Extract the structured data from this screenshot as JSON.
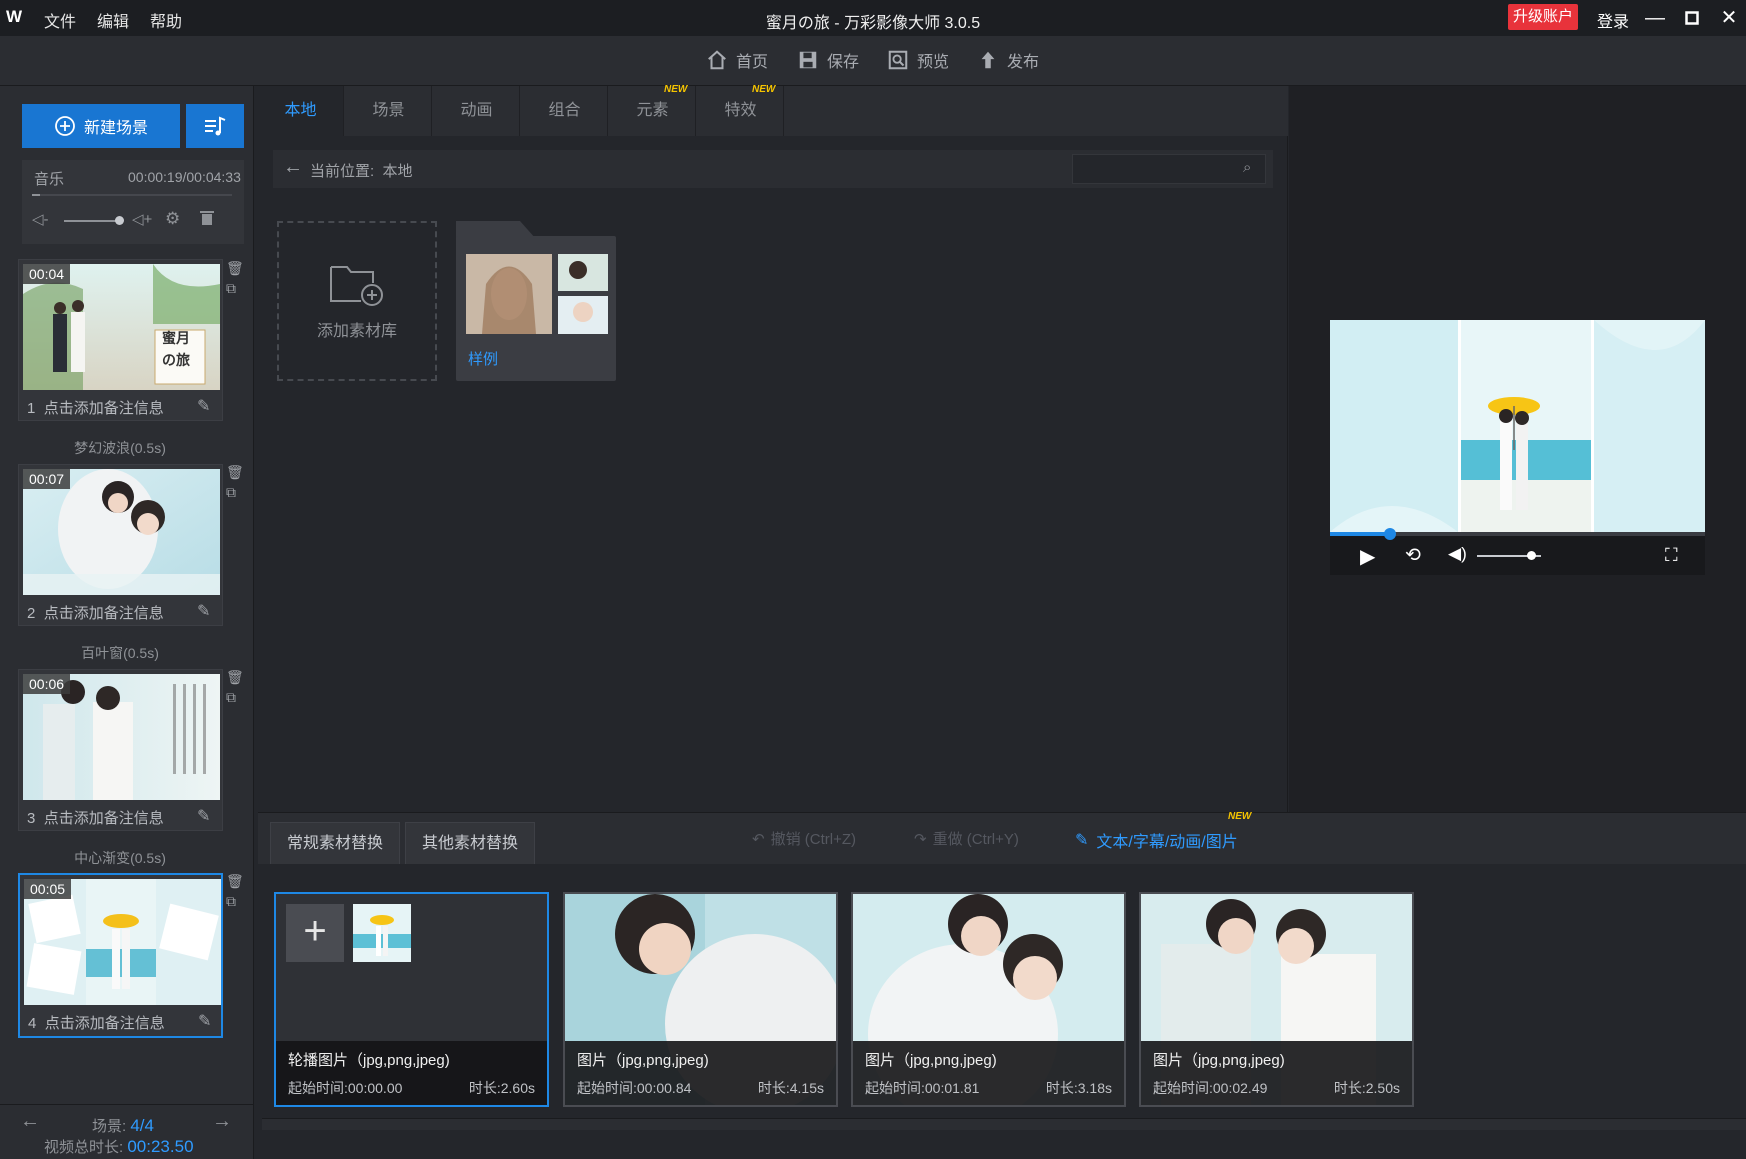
{
  "app": {
    "logo": "W",
    "title": "蜜月の旅 - 万彩影像大师 3.0.5",
    "menu": [
      "文件",
      "编辑",
      "帮助"
    ],
    "upgrade_label": "升级账户",
    "login_label": "登录"
  },
  "toolbar": {
    "home": "首页",
    "save": "保存",
    "preview": "预览",
    "publish": "发布"
  },
  "left": {
    "new_scene_label": "新建场景",
    "music_label": "音乐",
    "music_time": "00:00:19/00:04:33",
    "music_volume": 0.95,
    "scenes": [
      {
        "index": "1",
        "time": "00:04",
        "note": "点击添加备注信息",
        "caption_line1": "蜜月",
        "caption_line2": "の旅"
      },
      {
        "index": "2",
        "time": "00:07",
        "note": "点击添加备注信息"
      },
      {
        "index": "3",
        "time": "00:06",
        "note": "点击添加备注信息"
      },
      {
        "index": "4",
        "time": "00:05",
        "note": "点击添加备注信息"
      }
    ],
    "transitions": [
      "梦幻波浪(0.5s)",
      "百叶窗(0.5s)",
      "中心渐变(0.5s)"
    ],
    "footer": {
      "scene_label": "场景:",
      "scene_count": "4/4",
      "total_label": "视频总时长:",
      "total_time": "00:23.50"
    }
  },
  "library": {
    "tabs": [
      "本地",
      "场景",
      "动画",
      "组合",
      "元素",
      "特效"
    ],
    "active_tab": 0,
    "new_badge": "NEW",
    "path_label": "当前位置:",
    "path_value": "本地",
    "search_placeholder": "",
    "add_library_label": "添加素材库",
    "folder_label": "样例"
  },
  "preview": {
    "progress": 0.16,
    "volume": 0.85
  },
  "replace": {
    "tab_regular": "常规素材替换",
    "tab_other": "其他素材替换",
    "undo": "撤销 (Ctrl+Z)",
    "redo": "重做 (Ctrl+Y)",
    "text_sub": "文本/字幕/动画/图片",
    "cards": [
      {
        "title": "轮播图片（jpg,png,jpeg)",
        "start": "起始时间:00:00.00",
        "duration": "时长:2.60s"
      },
      {
        "title": "图片（jpg,png,jpeg)",
        "start": "起始时间:00:00.84",
        "duration": "时长:4.15s"
      },
      {
        "title": "图片（jpg,png,jpeg)",
        "start": "起始时间:00:01.81",
        "duration": "时长:3.18s"
      },
      {
        "title": "图片（jpg,png,jpeg)",
        "start": "起始时间:00:02.49",
        "duration": "时长:2.50s"
      }
    ]
  },
  "colors": {
    "accent": "#1976d2",
    "link": "#2f9bff",
    "upgrade": "#e8333b",
    "new_badge": "#f5c400"
  }
}
